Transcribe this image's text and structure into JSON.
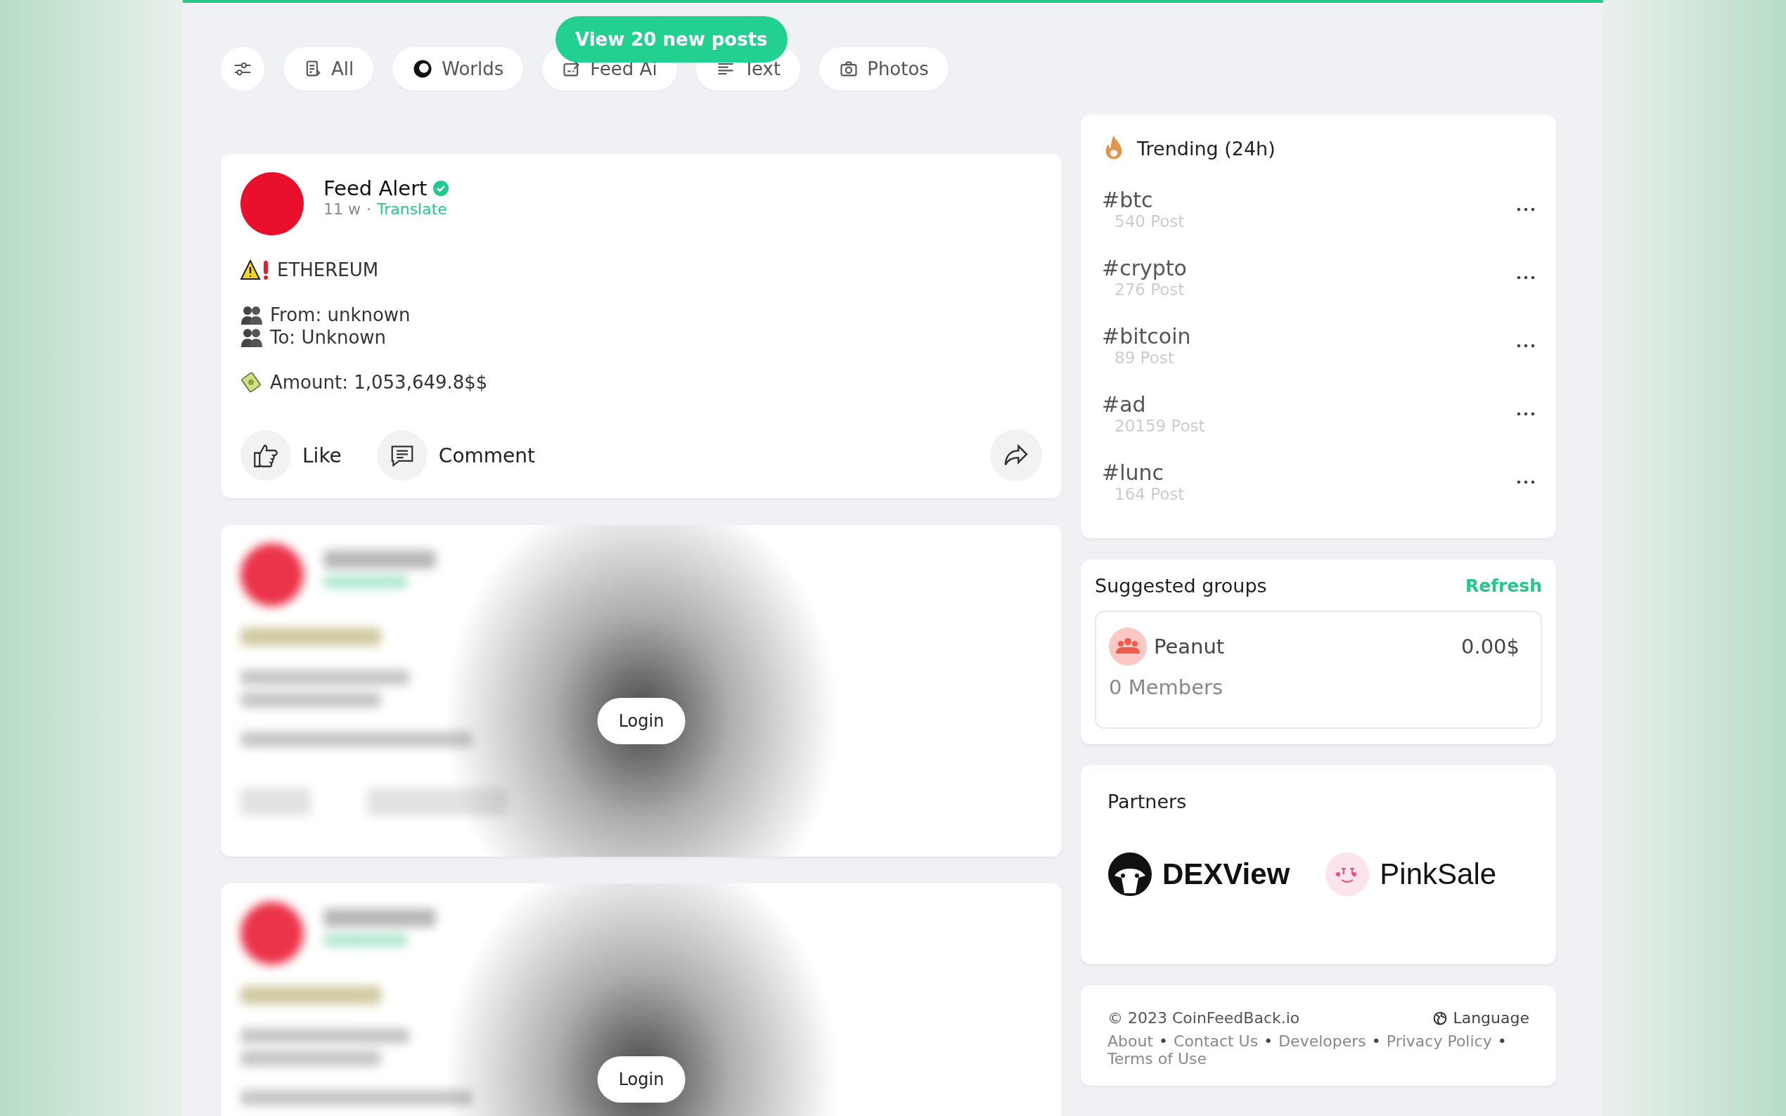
{
  "new_posts_button": "View 20 new posts",
  "filters": [
    {
      "label": "All"
    },
    {
      "label": "Worlds"
    },
    {
      "label": "Feed Ai"
    },
    {
      "label": "Text"
    },
    {
      "label": "Photos"
    }
  ],
  "post": {
    "author": "Feed Alert",
    "verified": true,
    "time": "11 w",
    "meta_separator": "·",
    "translate": "Translate",
    "blocks": [
      [
        {
          "kind": "warning",
          "text": "ETHEREUM"
        }
      ],
      [
        {
          "kind": "people",
          "text": "From: unknown"
        },
        {
          "kind": "people",
          "text": "To: Unknown"
        }
      ],
      [
        {
          "kind": "money",
          "text": "Amount: 1,053,649.8$$"
        }
      ]
    ],
    "like": "Like",
    "comment": "Comment"
  },
  "locked_posts": [
    {
      "login": "Login"
    },
    {
      "login": "Login"
    }
  ],
  "trending": {
    "title": "Trending (24h)",
    "items": [
      {
        "tag": "#btc",
        "count": "540 Post"
      },
      {
        "tag": "#crypto",
        "count": "276 Post"
      },
      {
        "tag": "#bitcoin",
        "count": "89 Post"
      },
      {
        "tag": "#ad",
        "count": "20159 Post"
      },
      {
        "tag": "#lunc",
        "count": "164 Post"
      }
    ]
  },
  "suggested_groups": {
    "title": "Suggested groups",
    "refresh": "Refresh",
    "groups": [
      {
        "name": "Peanut",
        "value": "0.00$",
        "members": "0 Members"
      }
    ]
  },
  "partners": {
    "title": "Partners",
    "items": [
      {
        "kind": "dexview",
        "name": "DEXView"
      },
      {
        "kind": "pinksale",
        "name": "PinkSale"
      }
    ]
  },
  "footer": {
    "copyright": "© 2023 CoinFeedBack.io",
    "language": "Language",
    "separator": "•",
    "links": [
      "About",
      "Contact Us",
      "Developers",
      "Privacy Policy",
      "Terms of Use"
    ]
  }
}
